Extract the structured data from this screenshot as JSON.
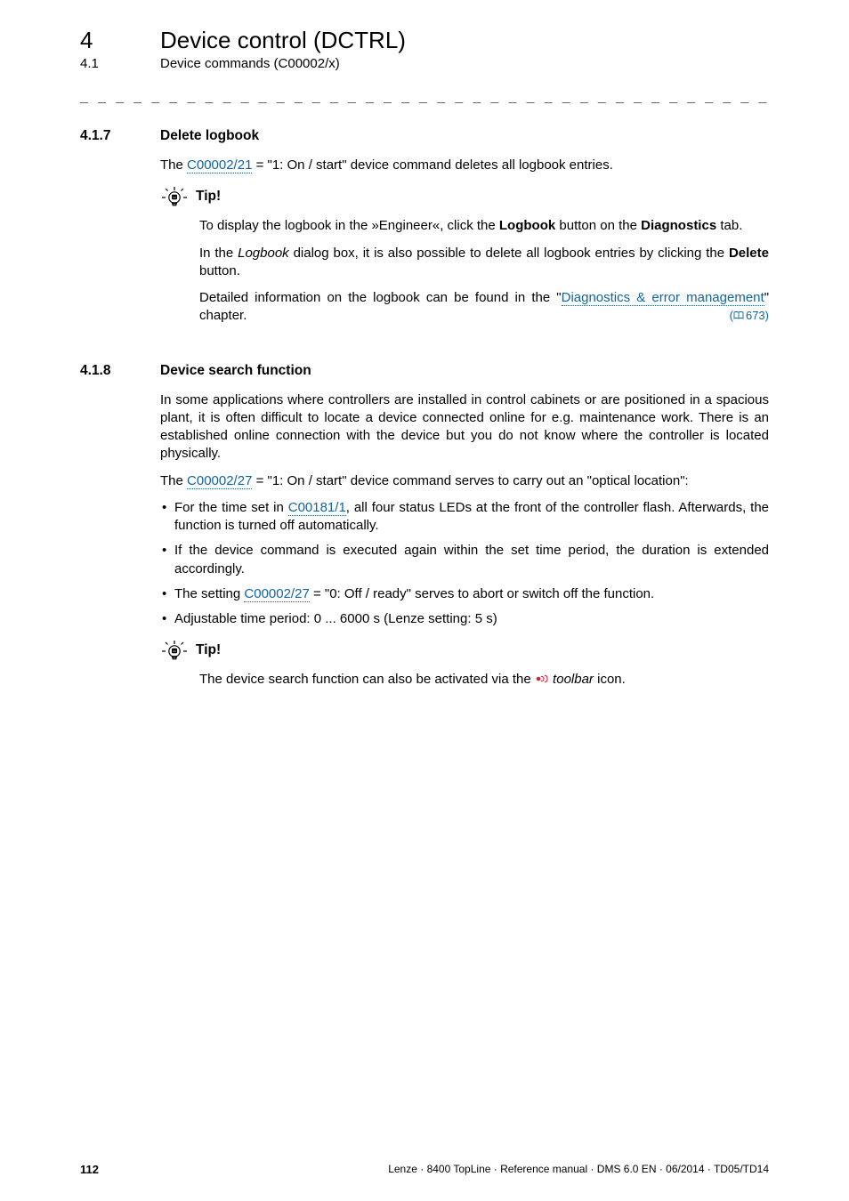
{
  "chapter": {
    "num": "4",
    "title": "Device control (DCTRL)"
  },
  "section": {
    "num": "4.1",
    "title": "Device commands (C00002/x)"
  },
  "dashes": "_ _ _ _ _ _ _ _ _ _ _ _ _ _ _ _ _ _ _ _ _ _ _ _ _ _ _ _ _ _ _ _ _ _ _ _ _ _ _ _ _ _ _ _ _ _ _ _ _ _ _ _ _ _ _ _ _ _ _ _ _ _ _ _",
  "s417": {
    "num": "4.1.7",
    "title": "Delete logbook",
    "p1_a": "The ",
    "p1_link": "C00002/21",
    "p1_b": " = \"1: On / start\" device command deletes all logbook entries.",
    "tip_label": "Tip!",
    "tip_p1_a": "To display the logbook in the »Engineer«, click the ",
    "tip_p1_bold1": "Logbook",
    "tip_p1_b": " button on the ",
    "tip_p1_bold2": "Diagnostics",
    "tip_p1_c": " tab.",
    "tip_p2_a": "In the ",
    "tip_p2_it": "Logbook",
    "tip_p2_b": " dialog box, it is also possible to delete all logbook entries by clicking the ",
    "tip_p2_bold": "Delete",
    "tip_p2_c": " button.",
    "tip_p3_a": "Detailed information on the logbook can be found in the \"",
    "tip_p3_link": "Diagnostics & error management",
    "tip_p3_b": "\" chapter. ",
    "tip_p3_ref": "673)"
  },
  "s418": {
    "num": "4.1.8",
    "title": "Device search function",
    "p1": "In some applications where controllers are installed in control cabinets or are positioned in a spacious plant, it is often difficult to locate a device connected online for e.g. maintenance work. There is an established online connection with the device but you do not know where the controller is located physically.",
    "p2_a": "The ",
    "p2_link": "C00002/27",
    "p2_b": " = \"1: On / start\" device command serves to carry out an \"optical location\":",
    "li1_a": "For the time set in ",
    "li1_link": "C00181/1",
    "li1_b": ", all four status LEDs at the front of the controller flash. Afterwards, the function is turned off automatically.",
    "li2": "If the device command is executed again within the set time period, the duration is extended accordingly.",
    "li3_a": "The setting ",
    "li3_link": "C00002/27",
    "li3_b": " = \"0: Off / ready\" serves to abort or switch off the function.",
    "li4": "Adjustable time period: 0 ... 6000 s (Lenze setting: 5 s)",
    "tip_label": "Tip!",
    "tip_p1_a": "The device search function can also be activated via the ",
    "tip_p1_it": " toolbar",
    "tip_p1_b": " icon."
  },
  "footer": {
    "page": "112",
    "right": "Lenze · 8400 TopLine · Reference manual · DMS 6.0 EN · 06/2014 · TD05/TD14"
  }
}
